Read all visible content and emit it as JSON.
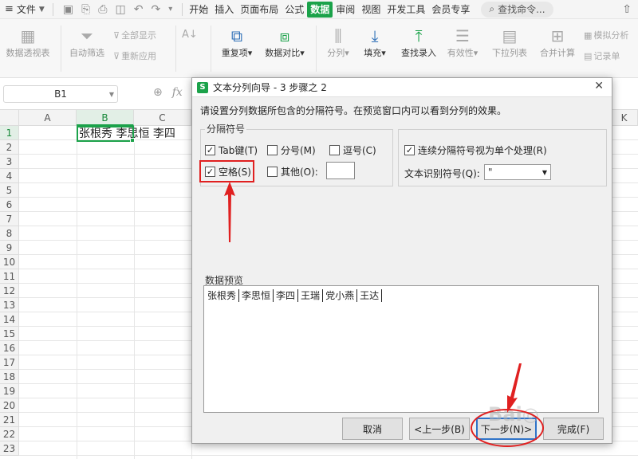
{
  "menubar": {
    "file_label": "文件",
    "tabs": [
      "开始",
      "插入",
      "页面布局",
      "公式",
      "数据",
      "审阅",
      "视图",
      "开发工具",
      "会员专享"
    ],
    "active_tab": "数据",
    "search_label": "查找命令..."
  },
  "ribbon": {
    "pivot": "数据透视表",
    "autofilter": "自动筛选",
    "show_all": "全部显示",
    "reapply": "重新应用",
    "sort": "A↓",
    "duplicates": "重复项▾",
    "compare": "数据对比▾",
    "split": "分列▾",
    "fill": "填充▾",
    "lookup": "查找录入",
    "validity": "有效性▾",
    "dropdown_list": "下拉列表",
    "consolidate": "合并计算",
    "simulate": "模拟分析",
    "record": "记录单"
  },
  "formula_bar": {
    "name_box": "B1",
    "fx": "fx"
  },
  "grid": {
    "columns": [
      "A",
      "B",
      "C",
      "K"
    ],
    "rows": [
      "1",
      "2",
      "3",
      "4",
      "5",
      "6",
      "7",
      "8",
      "9",
      "10",
      "11",
      "12",
      "13",
      "14",
      "15",
      "16",
      "17",
      "18",
      "19",
      "20",
      "21",
      "22",
      "23"
    ],
    "b1_text": "张根秀  李思恒  李四"
  },
  "dialog": {
    "title": "文本分列向导 - 3 步骤之 2",
    "close": "✕",
    "description": "请设置分列数据所包含的分隔符号。在预览窗口内可以看到分列的效果。",
    "delimiters_group": "分隔符号",
    "tab_key": "Tab键(T)",
    "semicolon": "分号(M)",
    "comma": "逗号(C)",
    "space": "空格(S)",
    "other": "其他(O):",
    "consecutive": "连续分隔符号视为单个处理(R)",
    "text_qualifier_label": "文本识别符号(Q):",
    "text_qualifier_value": "\"",
    "preview_label": "数据预览",
    "preview_cells": [
      "张根秀",
      "李思恒",
      "李四",
      "王瑞",
      "党小燕",
      "王达"
    ],
    "buttons": {
      "cancel": "取消",
      "back": "<上一步(B)",
      "next": "下一步(N)>",
      "finish": "完成(F)"
    },
    "checked": {
      "tab": true,
      "semicolon": false,
      "comma": false,
      "space": true,
      "other": false,
      "consecutive": true
    }
  },
  "colors": {
    "accent_green": "#1ba24a",
    "annotation_red": "#e02020",
    "default_button_blue": "#2f73c8"
  }
}
